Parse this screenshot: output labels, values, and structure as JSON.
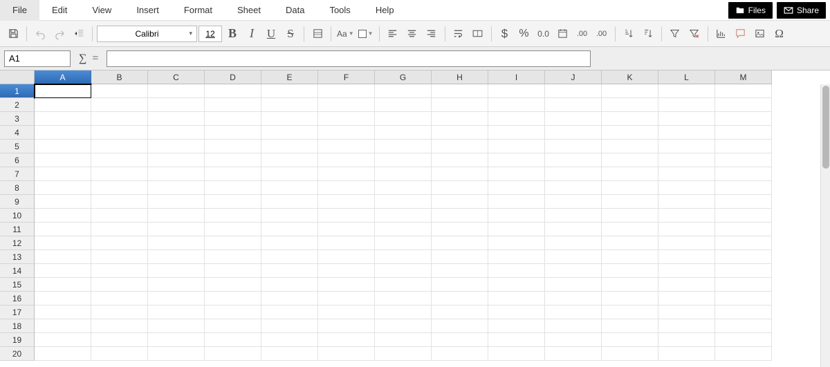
{
  "menu": [
    "File",
    "Edit",
    "View",
    "Insert",
    "Format",
    "Sheet",
    "Data",
    "Tools",
    "Help"
  ],
  "corner": {
    "files": "Files",
    "share": "Share"
  },
  "toolbar": {
    "font": "Calibri",
    "size": "12",
    "aa": "Aa"
  },
  "formula": {
    "cellref": "A1",
    "sigma": "∑",
    "eq": "="
  },
  "columns": [
    "A",
    "B",
    "C",
    "D",
    "E",
    "F",
    "G",
    "H",
    "I",
    "J",
    "K",
    "L",
    "M"
  ],
  "rows": [
    "1",
    "2",
    "3",
    "4",
    "5",
    "6",
    "7",
    "8",
    "9",
    "10",
    "11",
    "12",
    "13",
    "14",
    "15",
    "16",
    "17",
    "18",
    "19",
    "20"
  ],
  "selected": {
    "col": 0,
    "row": 0
  }
}
